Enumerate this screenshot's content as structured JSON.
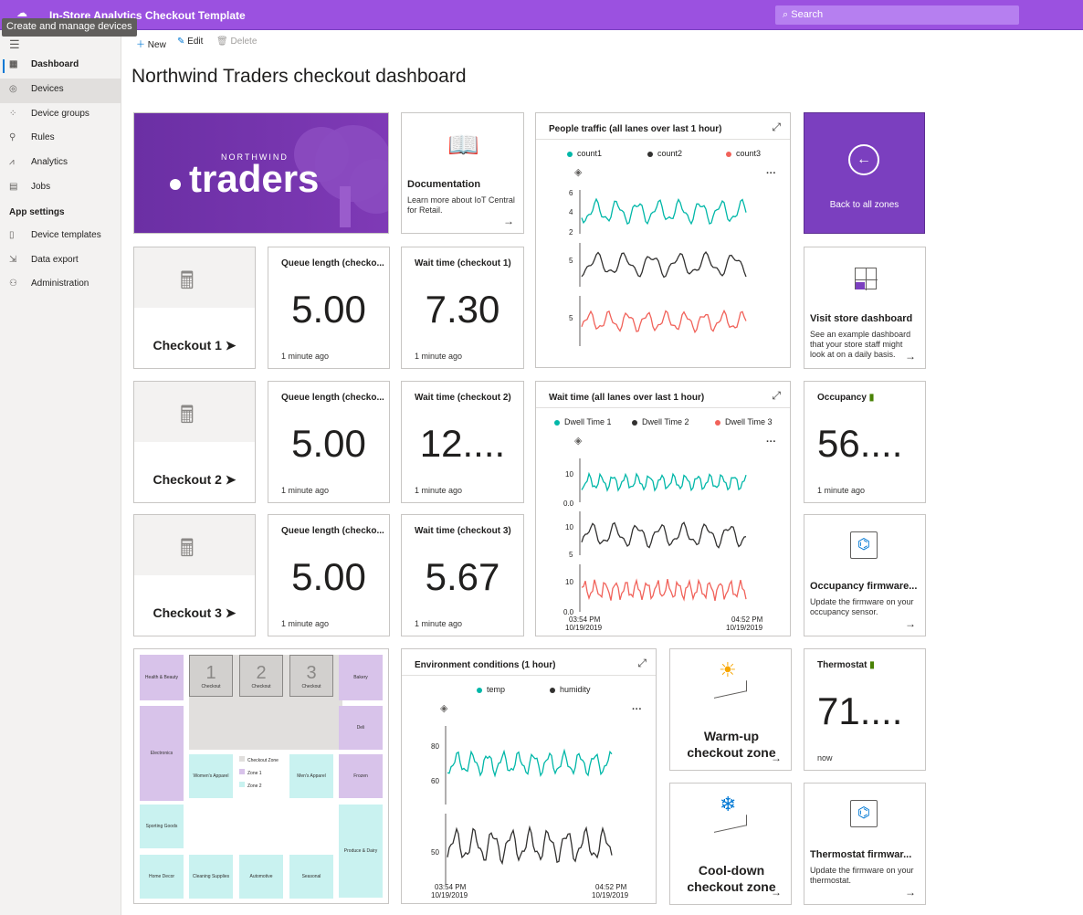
{
  "app": {
    "title": "In-Store Analytics Checkout Template",
    "search_placeholder": "Search",
    "tooltip": "Create and manage devices"
  },
  "sidebar": {
    "items": [
      {
        "label": "Dashboard",
        "icon": "dashboard-icon"
      },
      {
        "label": "Devices",
        "icon": "devices-icon"
      },
      {
        "label": "Device groups",
        "icon": "device-groups-icon"
      },
      {
        "label": "Rules",
        "icon": "rules-icon"
      },
      {
        "label": "Analytics",
        "icon": "analytics-icon"
      },
      {
        "label": "Jobs",
        "icon": "jobs-icon"
      }
    ],
    "section": "App settings",
    "settings": [
      {
        "label": "Device templates",
        "icon": "device-templates-icon"
      },
      {
        "label": "Data export",
        "icon": "data-export-icon"
      },
      {
        "label": "Administration",
        "icon": "administration-icon"
      }
    ]
  },
  "commands": {
    "new": "New",
    "edit": "Edit",
    "delete": "Delete"
  },
  "page": {
    "title": "Northwind Traders checkout dashboard"
  },
  "brand": {
    "small": "NORTHWIND",
    "big": "traders"
  },
  "documentation": {
    "title": "Documentation",
    "desc": "Learn more about IoT Central for Retail."
  },
  "people_traffic": {
    "title": "People traffic (all lanes over last 1 hour)",
    "legend": [
      "count1",
      "count2",
      "count3"
    ],
    "colors": [
      "#00b7a8",
      "#323130",
      "#f1625a"
    ],
    "ticks": [
      "6",
      "4",
      "2",
      "5",
      "5"
    ]
  },
  "back_zones": {
    "label": "Back to all zones"
  },
  "checkouts": [
    {
      "label": "Checkout 1 ➤",
      "queue_title": "Queue length (checko...",
      "queue": "5.00",
      "wait_title": "Wait time (checkout 1)",
      "wait": "7.30",
      "ago": "1 minute ago"
    },
    {
      "label": "Checkout 2 ➤",
      "queue_title": "Queue length (checko...",
      "queue": "5.00",
      "wait_title": "Wait time (checkout 2)",
      "wait": "12....",
      "ago": "1 minute ago"
    },
    {
      "label": "Checkout 3 ➤",
      "queue_title": "Queue length (checko...",
      "queue": "5.00",
      "wait_title": "Wait time (checkout 3)",
      "wait": "5.67",
      "ago": "1 minute ago"
    }
  ],
  "store_dashboard": {
    "title": "Visit store dashboard",
    "desc": "See an example dashboard that your store staff might look at on a daily basis."
  },
  "wait_time_chart": {
    "title": "Wait time (all lanes over last 1 hour)",
    "legend": [
      "Dwell Time 1",
      "Dwell Time 2",
      "Dwell Time 3"
    ],
    "ticks": [
      "10",
      "0.0",
      "10",
      "5",
      "10",
      "0.0"
    ],
    "x_start": "03:54 PM",
    "x_start_date": "10/19/2019",
    "x_end": "04:52 PM",
    "x_end_date": "10/19/2019"
  },
  "occupancy": {
    "title": "Occupancy",
    "value": "56....",
    "ago": "1 minute ago"
  },
  "occupancy_firmware": {
    "title": "Occupancy firmware...",
    "desc": "Update the firmware on your occupancy sensor."
  },
  "floorplan": {
    "checkouts": [
      {
        "num": "1",
        "label": "Checkout"
      },
      {
        "num": "2",
        "label": "Checkout"
      },
      {
        "num": "3",
        "label": "Checkout"
      }
    ],
    "rooms": {
      "health": "Health & Beauty",
      "bakery": "Bakery",
      "electronics": "Electronics",
      "deli": "Deli",
      "women": "Women's Apparel",
      "men": "Men's Apparel",
      "frozen": "Frozen",
      "sporting": "Sporting Goods",
      "produce": "Produce & Dairy",
      "home": "Home Decor",
      "cleaning": "Cleaning Supplies",
      "automotive": "Automotive",
      "seasonal": "Seasonal"
    },
    "legend": [
      "Checkout Zone",
      "Zone 1",
      "Zone 2"
    ]
  },
  "environment": {
    "title": "Environment conditions (1 hour)",
    "legend": [
      "temp",
      "humidity"
    ],
    "ticks": [
      "80",
      "60",
      "50"
    ],
    "x_start": "03:54 PM",
    "x_start_date": "10/19/2019",
    "x_end": "04:52 PM",
    "x_end_date": "10/19/2019"
  },
  "warmup": {
    "label": "Warm-up checkout zone"
  },
  "cooldown": {
    "label": "Cool-down checkout zone"
  },
  "thermostat": {
    "title": "Thermostat",
    "value": "71....",
    "ago": "now"
  },
  "thermostat_firmware": {
    "title": "Thermostat firmwar...",
    "desc": "Update the firmware on your thermostat."
  }
}
